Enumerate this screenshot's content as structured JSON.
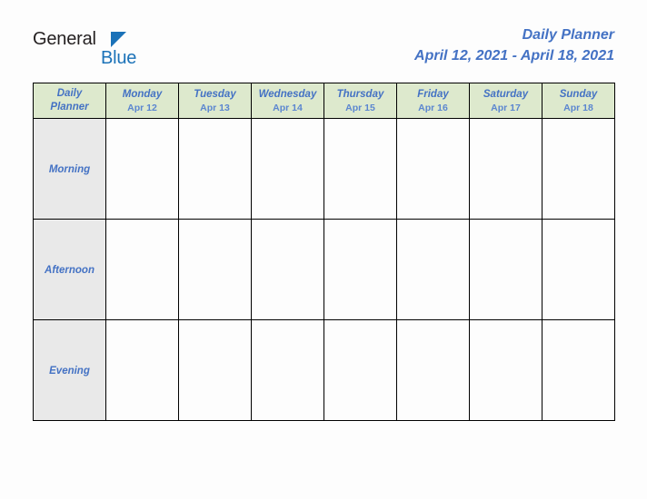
{
  "branding": {
    "logo_primary": "General",
    "logo_secondary": "Blue",
    "logo_triangle_icon": "triangle-icon",
    "primary_color": "#231f20",
    "accent_color": "#1b72b8"
  },
  "header": {
    "title": "Daily Planner",
    "date_range": "April 12, 2021 - April 18, 2021",
    "title_color": "#4472c4"
  },
  "planner": {
    "corner_label_line1": "Daily",
    "corner_label_line2": "Planner",
    "header_background": "#dde9cd",
    "row_label_background": "#e9e9e9",
    "cell_background": "#fdfdfd",
    "border_color": "#000000",
    "days": [
      {
        "name": "Monday",
        "date": "Apr 12"
      },
      {
        "name": "Tuesday",
        "date": "Apr 13"
      },
      {
        "name": "Wednesday",
        "date": "Apr 14"
      },
      {
        "name": "Thursday",
        "date": "Apr 15"
      },
      {
        "name": "Friday",
        "date": "Apr 16"
      },
      {
        "name": "Saturday",
        "date": "Apr 17"
      },
      {
        "name": "Sunday",
        "date": "Apr 18"
      }
    ],
    "time_slots": [
      {
        "label": "Morning",
        "entries": [
          "",
          "",
          "",
          "",
          "",
          "",
          ""
        ]
      },
      {
        "label": "Afternoon",
        "entries": [
          "",
          "",
          "",
          "",
          "",
          "",
          ""
        ]
      },
      {
        "label": "Evening",
        "entries": [
          "",
          "",
          "",
          "",
          "",
          "",
          ""
        ]
      }
    ]
  }
}
